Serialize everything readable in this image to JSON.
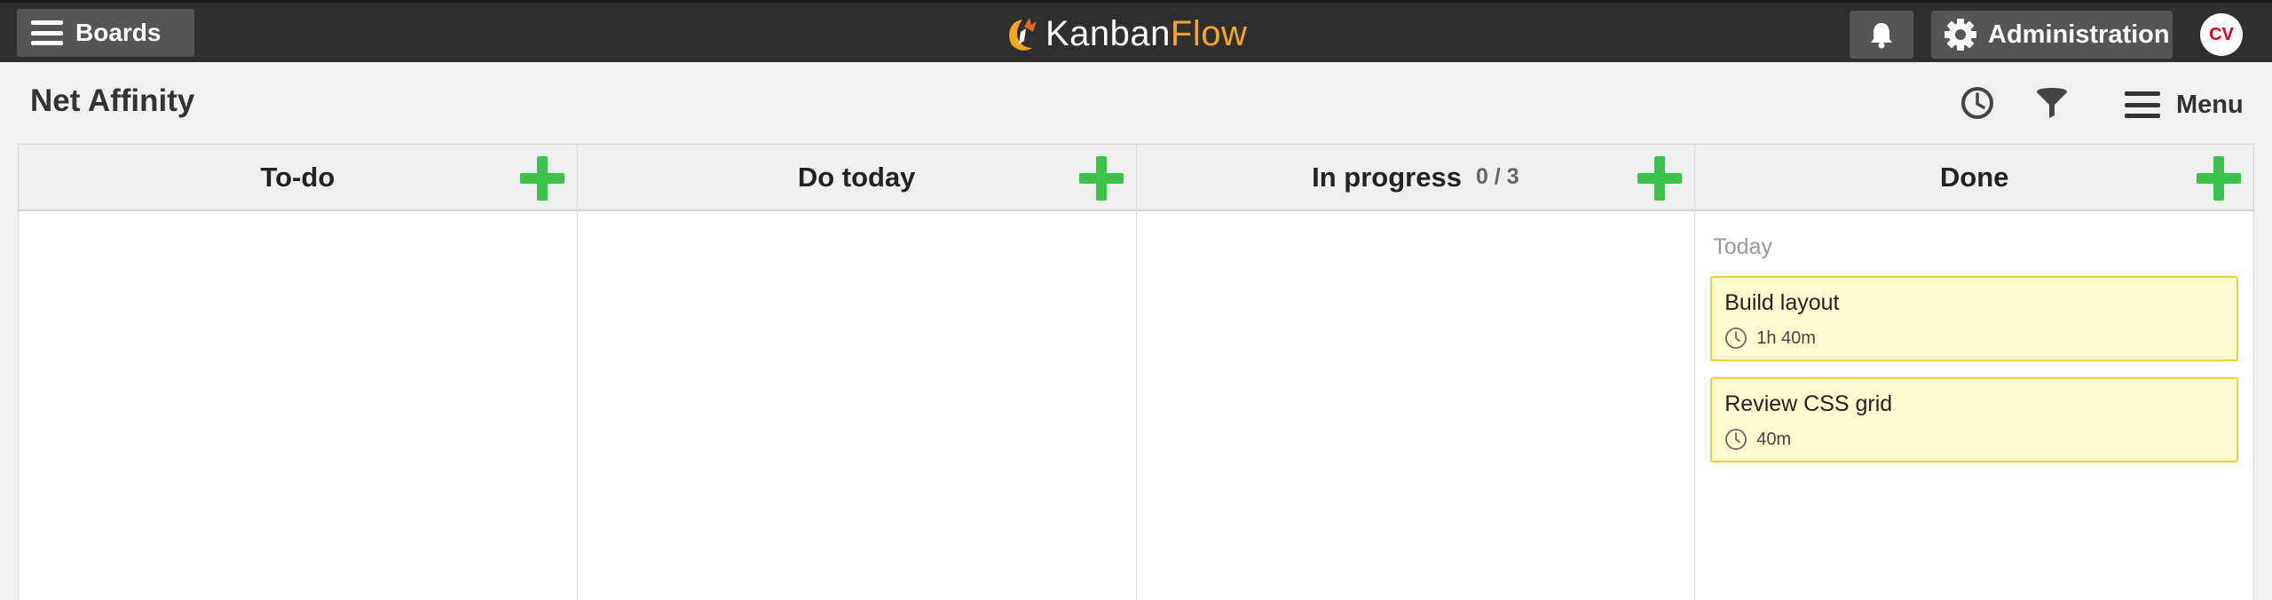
{
  "topbar": {
    "boards_label": "Boards",
    "logo_part1": "Kanban",
    "logo_part2": "Flow",
    "admin_label": "Administration",
    "avatar_initials": "CV"
  },
  "header": {
    "board_title": "Net Affinity",
    "menu_label": "Menu"
  },
  "columns": [
    {
      "title": "To-do",
      "wip": ""
    },
    {
      "title": "Do today",
      "wip": ""
    },
    {
      "title": "In progress",
      "wip": "0 / 3"
    },
    {
      "title": "Done",
      "wip": ""
    }
  ],
  "done": {
    "group_label": "Today",
    "tasks": [
      {
        "title": "Build layout",
        "time": "1h 40m"
      },
      {
        "title": "Review CSS grid",
        "time": "40m"
      }
    ]
  },
  "colors": {
    "topbar": "#2f2f2f",
    "add_green": "#3cc14b",
    "task_bg": "#fefccf",
    "task_border": "#f1cf3a",
    "logo_accent": "#f5a623"
  },
  "icons": [
    "hamburger-icon",
    "bell-icon",
    "gear-icon",
    "history-icon",
    "filter-icon",
    "plus-icon",
    "clock-icon"
  ]
}
